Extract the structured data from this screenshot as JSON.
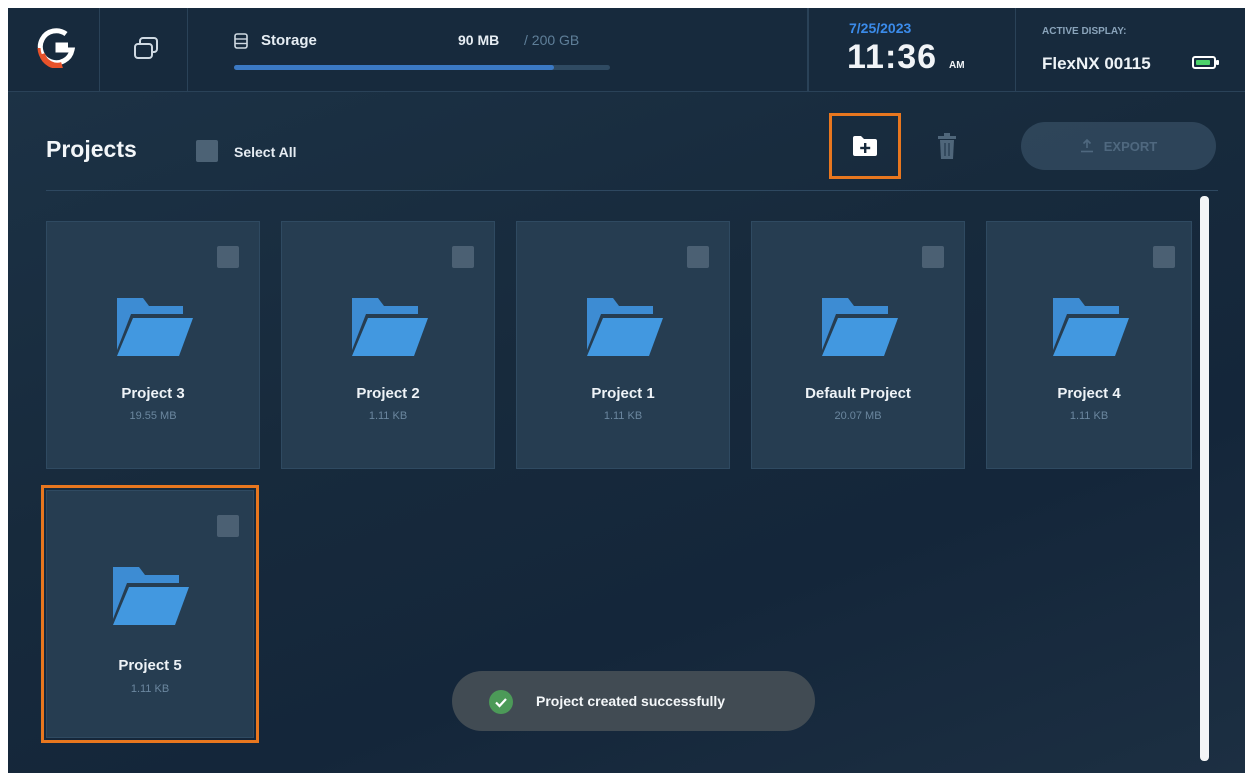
{
  "topbar": {
    "storage": {
      "label": "Storage",
      "used": "90 MB",
      "total": "/ 200 GB",
      "usage_fraction": 0.85
    },
    "date": "7/25/2023",
    "time": "11:36",
    "ampm": "AM",
    "display_label": "ACTIVE DISPLAY:",
    "display_name": "FlexNX 00115"
  },
  "toolbar": {
    "title": "Projects",
    "select_all": "Select All",
    "export_label": "EXPORT"
  },
  "projects": [
    {
      "name": "Project 3",
      "size": "19.55 MB"
    },
    {
      "name": "Project 2",
      "size": "1.11 KB"
    },
    {
      "name": "Project 1",
      "size": "1.11 KB"
    },
    {
      "name": "Default Project",
      "size": "20.07 MB"
    },
    {
      "name": "Project 4",
      "size": "1.11 KB"
    },
    {
      "name": "Project 5",
      "size": "1.11 KB"
    }
  ],
  "toast": {
    "message": "Project created successfully"
  },
  "colors": {
    "accent": "#3b8bea",
    "highlight": "#e8771f",
    "folder": "#3f8fd8",
    "success": "#4c9a58"
  }
}
